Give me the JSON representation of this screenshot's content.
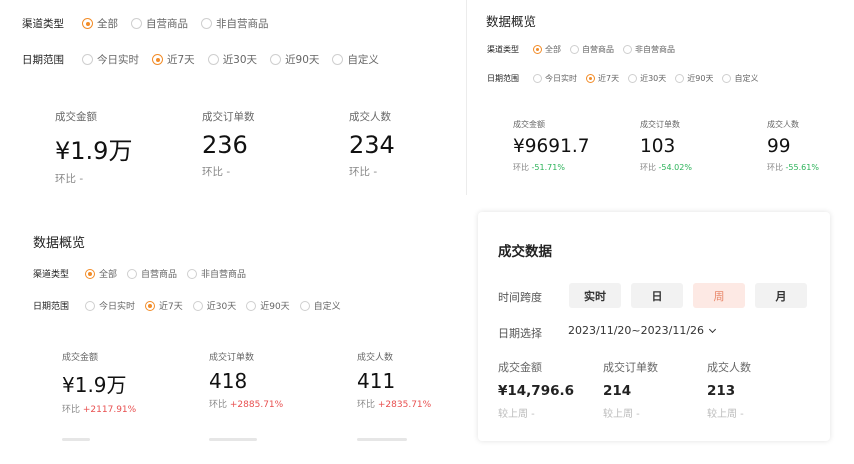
{
  "panel1": {
    "channel_label": "渠道类型",
    "channel_options": [
      "全部",
      "自营商品",
      "非自营商品"
    ],
    "date_label": "日期范围",
    "date_options": [
      "今日实时",
      "近7天",
      "近30天",
      "近90天",
      "自定义"
    ],
    "metrics": [
      {
        "label": "成交金额",
        "value": "¥1.9万",
        "cmp": "环比 -"
      },
      {
        "label": "成交订单数",
        "value": "236",
        "cmp": "环比 -"
      },
      {
        "label": "成交人数",
        "value": "234",
        "cmp": "环比 -"
      }
    ]
  },
  "panel2": {
    "title": "数据概览",
    "channel_label": "渠道类型",
    "channel_options": [
      "全部",
      "自营商品",
      "非自营商品"
    ],
    "date_label": "日期范围",
    "date_options": [
      "今日实时",
      "近7天",
      "近30天",
      "近90天",
      "自定义"
    ],
    "metrics": [
      {
        "label": "成交金额",
        "value": "¥9691.7",
        "cmp_prefix": "环比",
        "cmp_value": "-51.71%"
      },
      {
        "label": "成交订单数",
        "value": "103",
        "cmp_prefix": "环比",
        "cmp_value": "-54.02%"
      },
      {
        "label": "成交人数",
        "value": "99",
        "cmp_prefix": "环比",
        "cmp_value": "-55.61%"
      }
    ]
  },
  "panel3": {
    "title": "数据概览",
    "channel_label": "渠道类型",
    "channel_options": [
      "全部",
      "自营商品",
      "非自营商品"
    ],
    "date_label": "日期范围",
    "date_options": [
      "今日实时",
      "近7天",
      "近30天",
      "近90天",
      "自定义"
    ],
    "metrics": [
      {
        "label": "成交金额",
        "value": "¥1.9万",
        "cmp_prefix": "环比",
        "cmp_value": "+2117.91%"
      },
      {
        "label": "成交订单数",
        "value": "418",
        "cmp_prefix": "环比",
        "cmp_value": "+2885.71%"
      },
      {
        "label": "成交人数",
        "value": "411",
        "cmp_prefix": "环比",
        "cmp_value": "+2835.71%"
      }
    ]
  },
  "panel4": {
    "title": "成交数据",
    "span_label": "时间跨度",
    "span_options": [
      "实时",
      "日",
      "周",
      "月"
    ],
    "date_label": "日期选择",
    "date_value": "2023/11/20~2023/11/26",
    "metrics": [
      {
        "label": "成交金额",
        "value": "¥14,796.6",
        "cmp": "较上周 -"
      },
      {
        "label": "成交订单数",
        "value": "214",
        "cmp": "较上周 -"
      },
      {
        "label": "成交人数",
        "value": "213",
        "cmp": "较上周 -"
      }
    ]
  },
  "colors": {
    "accent_orange": "#f28c28",
    "decrease_green": "#2db35a",
    "increase_red": "#e85050",
    "active_tab_bg": "#fde9e4",
    "active_tab_text": "#e8876a"
  }
}
